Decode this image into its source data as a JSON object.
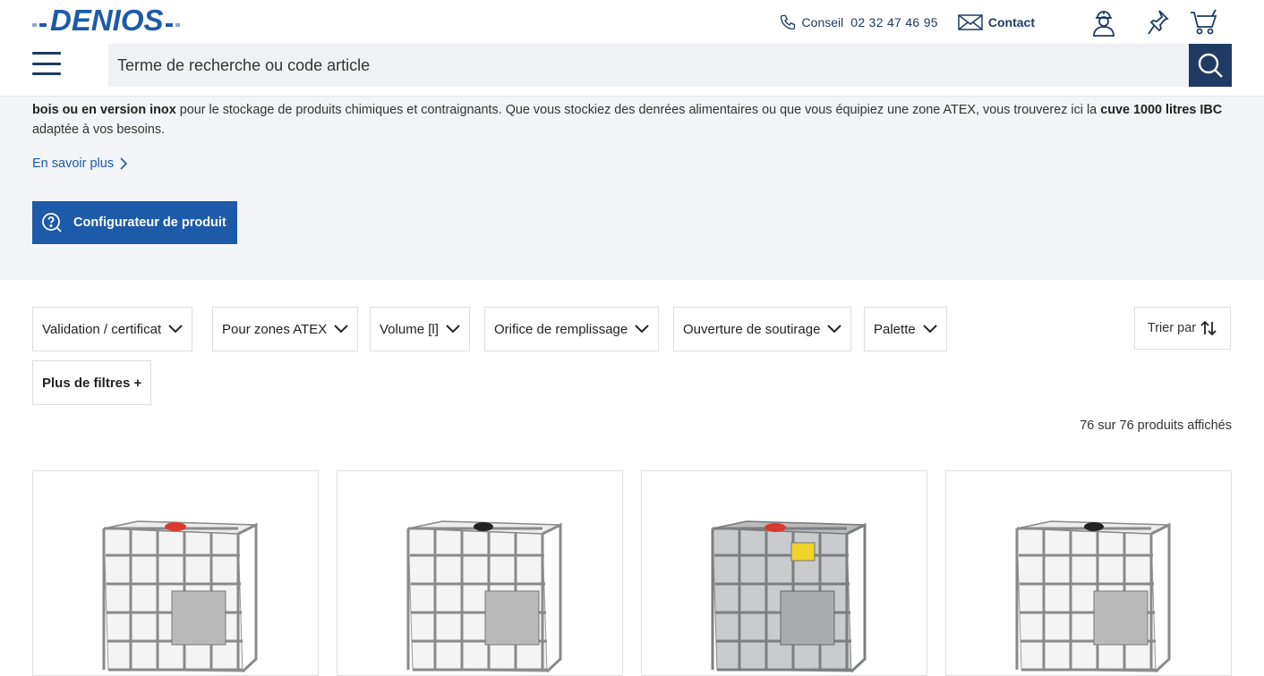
{
  "brand": {
    "name": "DENIOS",
    "color": "#1d5aa8",
    "dark": "#1f3b63"
  },
  "header": {
    "phone_label": "Conseil",
    "phone_number": "02 32 47 46 95",
    "contact_label": "Contact",
    "icons": [
      "phone-icon",
      "mail-icon",
      "account-icon",
      "pin-icon",
      "cart-icon",
      "menu-icon",
      "search-icon"
    ]
  },
  "search": {
    "placeholder": "Terme de recherche ou code article"
  },
  "hero": {
    "text_part1": "bois ou en version inox",
    "text_part2": " pour le stockage de produits chimiques et contraignants. Que vous stockiez des denrées alimentaires ou que vous équipiez une zone ATEX, vous trouverez ici la ",
    "text_part3": "cuve 1000 litres IBC",
    "text_part4": " adaptée à vos besoins.",
    "learn_more": "En savoir plus",
    "configurator": "Configurateur de produit"
  },
  "filters": [
    {
      "label": "Validation / certificat"
    },
    {
      "label": "Pour zones ATEX"
    },
    {
      "label": "Volume [l]"
    },
    {
      "label": "Orifice de remplissage"
    },
    {
      "label": "Ouverture de soutirage"
    },
    {
      "label": "Palette"
    }
  ],
  "more_filters": "Plus de filtres +",
  "sort_label": "Trier par",
  "result_count": "76 sur 76 produits affichés",
  "products": [
    {
      "image": "ibc-white-red-cap",
      "cap_color": "#d93a2b"
    },
    {
      "image": "ibc-white-black-cap",
      "cap_color": "#222222"
    },
    {
      "image": "ibc-steel-red-cap",
      "cap_color": "#d93a2b"
    },
    {
      "image": "ibc-white-black-cap",
      "cap_color": "#222222"
    }
  ]
}
